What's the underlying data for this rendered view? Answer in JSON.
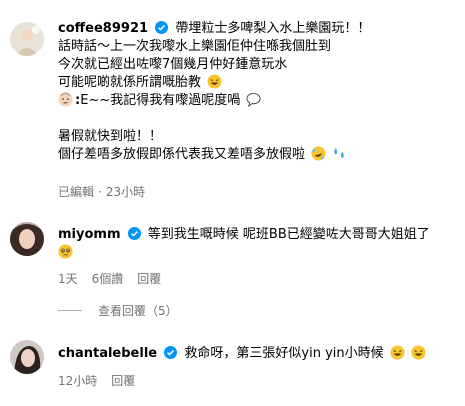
{
  "comments": [
    {
      "username": "coffee89921",
      "lines": [
        "帶埋粒士多啤梨入水上樂園玩！！",
        "話時話～上一次我嚟水上樂園佢仲住喺我個肚到",
        "今次就已經出咗嚟7個幾月仲好鍾意玩水",
        "可能呢啲就係所謂嘅胎教",
        "E~~我記得我有嚟過呢度喎",
        "",
        "暑假就快到啦！！",
        "個仔差唔多放假即係代表我又差唔多放假啦"
      ],
      "meta": {
        "edited": "已編輯",
        "dot": "·",
        "time": "23小時"
      }
    },
    {
      "username": "miyomm",
      "lines": [
        "等到我生嘅時候 呢班BB已經變咗大哥哥大姐姐了"
      ],
      "meta": {
        "time": "1天",
        "likes": "6個讚",
        "reply": "回覆"
      },
      "view_replies": "查看回覆（5）"
    },
    {
      "username": "chantalebelle",
      "lines": [
        "救命呀，第三張好似yin yin小時候"
      ],
      "meta": {
        "time": "12小時",
        "reply": "回覆"
      }
    }
  ],
  "colors": {
    "verified": "#0095f6",
    "meta_text": "#737373"
  },
  "icons": [
    "verified-badge-icon",
    "laughing-emoji-icon",
    "baby-emoji-icon",
    "speech-bubble-icon",
    "rolling-laughing-emoji-icon",
    "sweat-drops-emoji-icon",
    "pleading-emoji-icon"
  ]
}
